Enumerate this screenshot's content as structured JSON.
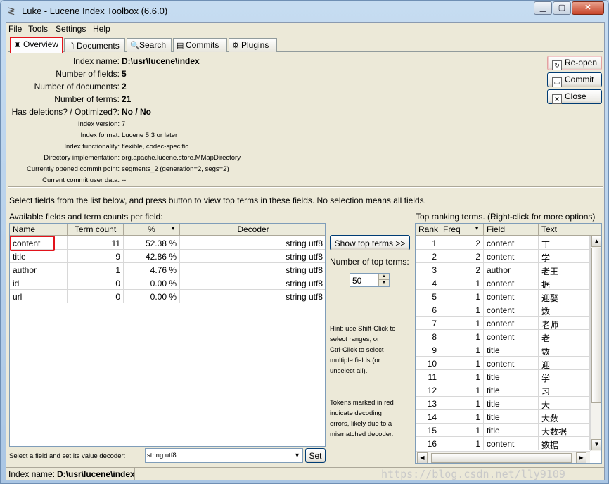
{
  "window": {
    "title": "Luke - Lucene Index Toolbox (6.6.0)"
  },
  "menu": [
    "File",
    "Tools",
    "Settings",
    "Help"
  ],
  "tabs": [
    "Overview",
    "Documents",
    "Search",
    "Commits",
    "Plugins"
  ],
  "overview": {
    "index_name_label": "Index name:",
    "index_name": "D:\\usr\\lucene\\index",
    "fields_label": "Number of fields:",
    "fields": "5",
    "docs_label": "Number of documents:",
    "docs": "2",
    "terms_label": "Number of terms:",
    "terms": "21",
    "deletions_label": "Has deletions? / Optimized?:",
    "deletions": "No / No",
    "version_label": "Index version:",
    "version": "7",
    "format_label": "Index format:",
    "format": "Lucene 5.3 or later",
    "functionality_label": "Index functionality:",
    "functionality": "flexible, codec-specific",
    "directory_label": "Directory implementation:",
    "directory": "org.apache.lucene.store.MMapDirectory",
    "commit_label": "Currently opened commit point:",
    "commit": "segments_2 (generation=2, segs=2)",
    "userdata_label": "Current commit user data:",
    "userdata": "--"
  },
  "side_buttons": {
    "reopen": "Re-open",
    "commit": "Commit",
    "close": "Close"
  },
  "instruction": "Select fields from the list below, and press button to view top terms in these fields. No selection means all fields.",
  "fields_panel": {
    "title": "Available fields and term counts per field:",
    "headers": [
      "Name",
      "Term count",
      "%",
      "Decoder"
    ],
    "rows": [
      [
        "content",
        "11",
        "52.38 %",
        "string utf8"
      ],
      [
        "title",
        "9",
        "42.86 %",
        "string utf8"
      ],
      [
        "author",
        "1",
        "4.76 %",
        "string utf8"
      ],
      [
        "id",
        "0",
        "0.00 %",
        "string utf8"
      ],
      [
        "url",
        "0",
        "0.00 %",
        "string utf8"
      ]
    ],
    "decoder_label": "Select a field and set its value decoder:",
    "decoder_value": "string utf8",
    "set_button": "Set"
  },
  "middle": {
    "show_button": "Show top terms >>",
    "num_label": "Number of top terms:",
    "num_value": "50",
    "hint1": "Hint: use Shift-Click to\nselect ranges, or\nCtrl-Click to select\nmultiple fields (or\nunselect all).",
    "hint2": "Tokens marked in red\nindicate decoding\nerrors, likely due to a\nmismatched decoder."
  },
  "terms_panel": {
    "title": "Top ranking terms. (Right-click for more options)",
    "headers": [
      "Rank",
      "Freq",
      "Field",
      "Text"
    ],
    "rows": [
      [
        "1",
        "2",
        "content",
        "丁"
      ],
      [
        "2",
        "2",
        "content",
        "学"
      ],
      [
        "3",
        "2",
        "author",
        "老王"
      ],
      [
        "4",
        "1",
        "content",
        "据"
      ],
      [
        "5",
        "1",
        "content",
        "迎娶"
      ],
      [
        "6",
        "1",
        "content",
        "数"
      ],
      [
        "7",
        "1",
        "content",
        "老师"
      ],
      [
        "8",
        "1",
        "content",
        "老"
      ],
      [
        "9",
        "1",
        "title",
        "数"
      ],
      [
        "10",
        "1",
        "content",
        "迎"
      ],
      [
        "11",
        "1",
        "title",
        "学"
      ],
      [
        "12",
        "1",
        "title",
        "习"
      ],
      [
        "13",
        "1",
        "title",
        "大"
      ],
      [
        "14",
        "1",
        "title",
        "大数"
      ],
      [
        "15",
        "1",
        "title",
        "大数据"
      ],
      [
        "16",
        "1",
        "content",
        "数据"
      ]
    ]
  },
  "status": {
    "label": "Index name:",
    "value": "D:\\usr\\lucene\\index"
  },
  "watermark": "https://blog.csdn.net/lly9109"
}
